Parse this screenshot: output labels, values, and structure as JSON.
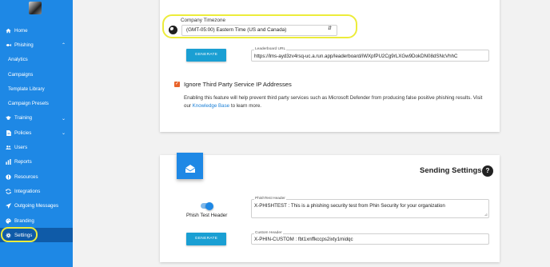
{
  "sidebar": {
    "items": [
      {
        "label": "Home",
        "icon": "home-icon",
        "type": "top"
      },
      {
        "label": "Phishing",
        "icon": "fish-icon",
        "type": "top",
        "expandable": true
      },
      {
        "label": "Analytics",
        "type": "sub"
      },
      {
        "label": "Campaigns",
        "type": "sub"
      },
      {
        "label": "Template Library",
        "type": "sub"
      },
      {
        "label": "Campaign Presets",
        "type": "sub"
      },
      {
        "label": "Training",
        "icon": "graduation-cap-icon",
        "type": "top",
        "expandable": true
      },
      {
        "label": "Policies",
        "icon": "document-icon",
        "type": "top",
        "expandable": true
      },
      {
        "label": "Users",
        "icon": "users-icon",
        "type": "top"
      },
      {
        "label": "Reports",
        "icon": "bar-chart-icon",
        "type": "top"
      },
      {
        "label": "Resources",
        "icon": "lightbulb-icon",
        "type": "top"
      },
      {
        "label": "Integrations",
        "icon": "sync-icon",
        "type": "top"
      },
      {
        "label": "Outgoing Messages",
        "icon": "send-icon",
        "type": "top"
      },
      {
        "label": "Branding",
        "icon": "palette-icon",
        "type": "top"
      },
      {
        "label": "Settings",
        "icon": "gear-icon",
        "type": "top",
        "active": true
      }
    ]
  },
  "timezone": {
    "label": "Company Timezone",
    "value": "(GMT-05:00) Eastern Time (US and Canada)"
  },
  "leaderboard": {
    "button_label": "GENERATE",
    "field_label": "Leaderboard URL",
    "field_value": "https://lms-ayd3zv4rsq-uc.a.run.app/leaderboard/iWXpfPU2Cg9rLXGw9DokDN08dSNcVhhC"
  },
  "ignore_ip": {
    "checked": true,
    "title": "Ignore Third Party Service IP Addresses",
    "description_before": "Enabling this feature will help prevent third party services such as Microsoft Defender from producing false positive phishing results. Visit our ",
    "link_text": "Knowledge Base",
    "description_after": " to learn more."
  },
  "sending_settings": {
    "title": "Sending Settings",
    "help_label": "?",
    "phish_test_header_toggle_label": "Phish Test Header",
    "phish_test_header_enabled": true,
    "phish_test_field_label": "PhishTest Header",
    "phish_test_field_value": "X-PHISHTEST : This is a phishing security test from Phin Security for your organization",
    "custom_header_button_label": "GENERATE",
    "custom_header_field_label": "Custom Header",
    "custom_header_field_value": "X-PHIN-CUSTOM : fbt1xnffkccps2ixty1midqc"
  },
  "colors": {
    "sidebar_bg": "#1e88e5",
    "sidebar_active_bg": "#0f5ba8",
    "highlight_ring": "#ecec3a",
    "button_bg": "#1a9fd3",
    "checkbox": "#e8632a",
    "link": "#1a7fd6"
  }
}
